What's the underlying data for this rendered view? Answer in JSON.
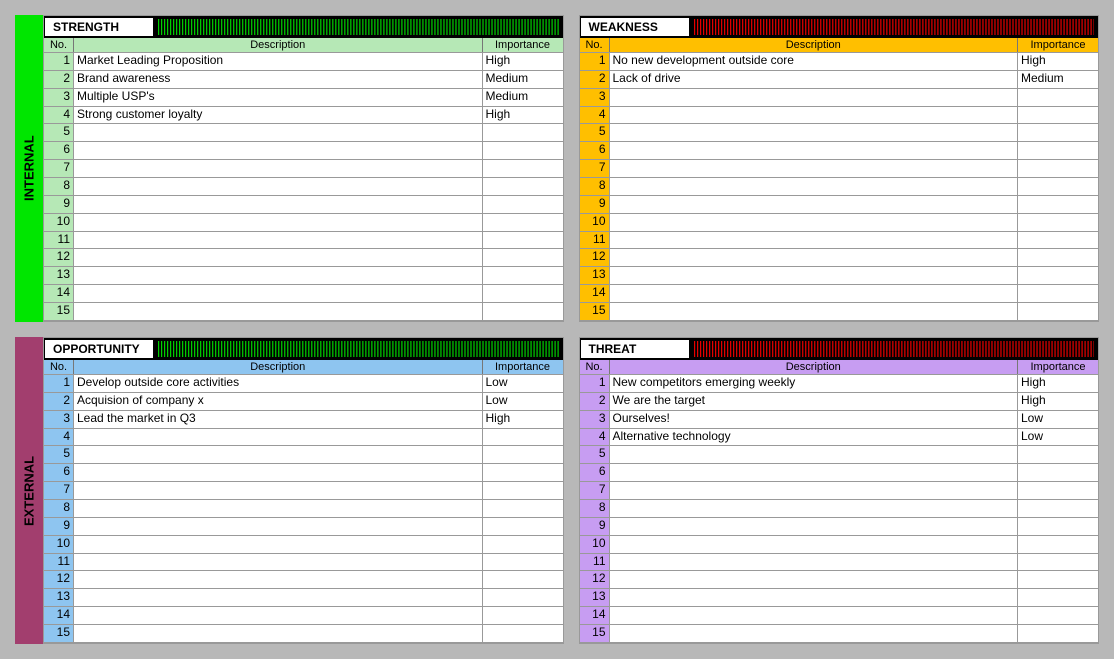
{
  "sideLabels": {
    "internal": "INTERNAL",
    "external": "EXTERNAL"
  },
  "headers": {
    "no": "No.",
    "description": "Description",
    "importance": "Importance"
  },
  "rowCount": 15,
  "quadrants": {
    "strength": {
      "title": "STRENGTH",
      "barColor": "#00d000",
      "rows": [
        {
          "no": 1,
          "desc": "Market Leading Proposition",
          "imp": "High"
        },
        {
          "no": 2,
          "desc": "Brand awareness",
          "imp": "Medium"
        },
        {
          "no": 3,
          "desc": "Multiple USP's",
          "imp": "Medium"
        },
        {
          "no": 4,
          "desc": "Strong customer loyalty",
          "imp": "High"
        }
      ]
    },
    "weakness": {
      "title": "WEAKNESS",
      "barColor": "#e60000",
      "rows": [
        {
          "no": 1,
          "desc": "No new development outside core",
          "imp": "High"
        },
        {
          "no": 2,
          "desc": "Lack of drive",
          "imp": "Medium"
        }
      ]
    },
    "opportunity": {
      "title": "OPPORTUNITY",
      "barColor": "#00d000",
      "rows": [
        {
          "no": 1,
          "desc": "Develop outside core activities",
          "imp": "Low"
        },
        {
          "no": 2,
          "desc": "Acquision of company x",
          "imp": "Low"
        },
        {
          "no": 3,
          "desc": "Lead the market in Q3",
          "imp": "High"
        }
      ]
    },
    "threat": {
      "title": "THREAT",
      "barColor": "#e60000",
      "rows": [
        {
          "no": 1,
          "desc": "New competitors emerging weekly",
          "imp": "High"
        },
        {
          "no": 2,
          "desc": "We are the target",
          "imp": "High"
        },
        {
          "no": 3,
          "desc": "Ourselves!",
          "imp": "Low"
        },
        {
          "no": 4,
          "desc": "Alternative technology",
          "imp": "Low"
        }
      ]
    }
  }
}
